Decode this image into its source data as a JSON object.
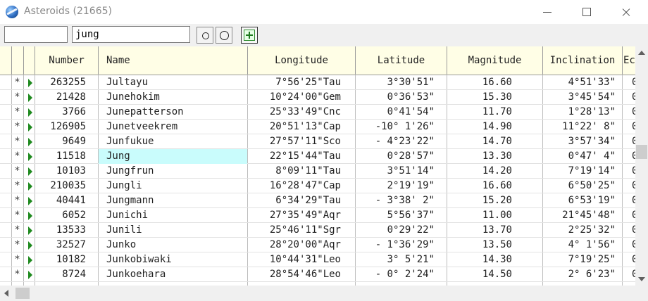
{
  "window": {
    "title": "Asteroids (21665)"
  },
  "toolbar": {
    "filter1_value": "",
    "search_value": "jung"
  },
  "columns": {
    "number": "Number",
    "name": "Name",
    "longitude": "Longitude",
    "latitude": "Latitude",
    "magnitude": "Magnitude",
    "inclination": "Inclination",
    "ecc": "Ec"
  },
  "rows": [
    {
      "marker": "*",
      "number": "263255",
      "name": "Jultayu",
      "longitude": "7°56'25\"Tau",
      "latitude": "3°30'51\"",
      "magnitude": "16.60",
      "inclination": "4°51'33\"",
      "ecc": "0"
    },
    {
      "marker": "*",
      "number": "21428",
      "name": "Junehokim",
      "longitude": "10°24'00\"Gem",
      "latitude": "0°36'53\"",
      "magnitude": "15.30",
      "inclination": "3°45'54\"",
      "ecc": "0"
    },
    {
      "marker": "*",
      "number": "3766",
      "name": "Junepatterson",
      "longitude": "25°33'49\"Cnc",
      "latitude": "0°41'54\"",
      "magnitude": "11.70",
      "inclination": "1°28'13\"",
      "ecc": "0"
    },
    {
      "marker": "*",
      "number": "126905",
      "name": "Junetveekrem",
      "longitude": "20°51'13\"Cap",
      "latitude": "-10° 1'26\"",
      "magnitude": "14.90",
      "inclination": "11°22' 8\"",
      "ecc": "0"
    },
    {
      "marker": "*",
      "number": "9649",
      "name": "Junfukue",
      "longitude": "27°57'11\"Sco",
      "latitude": "- 4°23'22\"",
      "magnitude": "14.70",
      "inclination": "3°57'34\"",
      "ecc": "0"
    },
    {
      "marker": "*",
      "number": "11518",
      "name": "Jung",
      "longitude": "22°15'44\"Tau",
      "latitude": "0°28'57\"",
      "magnitude": "13.30",
      "inclination": "0°47' 4\"",
      "ecc": "0",
      "selected": true
    },
    {
      "marker": "*",
      "number": "10103",
      "name": "Jungfrun",
      "longitude": "8°09'11\"Tau",
      "latitude": "3°51'14\"",
      "magnitude": "14.20",
      "inclination": "7°19'14\"",
      "ecc": "0"
    },
    {
      "marker": "*",
      "number": "210035",
      "name": "Jungli",
      "longitude": "16°28'47\"Cap",
      "latitude": "2°19'19\"",
      "magnitude": "16.60",
      "inclination": "6°50'25\"",
      "ecc": "0"
    },
    {
      "marker": "*",
      "number": "40441",
      "name": "Jungmann",
      "longitude": "6°34'29\"Tau",
      "latitude": "- 3°38' 2\"",
      "magnitude": "15.20",
      "inclination": "6°53'19\"",
      "ecc": "0"
    },
    {
      "marker": "*",
      "number": "6052",
      "name": "Junichi",
      "longitude": "27°35'49\"Aqr",
      "latitude": "5°56'37\"",
      "magnitude": "11.00",
      "inclination": "21°45'48\"",
      "ecc": "0"
    },
    {
      "marker": "*",
      "number": "13533",
      "name": "Junili",
      "longitude": "25°46'11\"Sgr",
      "latitude": "0°29'22\"",
      "magnitude": "13.70",
      "inclination": "2°25'32\"",
      "ecc": "0"
    },
    {
      "marker": "*",
      "number": "32527",
      "name": "Junko",
      "longitude": "28°20'00\"Aqr",
      "latitude": "- 1°36'29\"",
      "magnitude": "13.50",
      "inclination": "4° 1'56\"",
      "ecc": "0"
    },
    {
      "marker": "*",
      "number": "10182",
      "name": "Junkobiwaki",
      "longitude": "10°44'31\"Leo",
      "latitude": "3° 5'21\"",
      "magnitude": "14.30",
      "inclination": "7°19'25\"",
      "ecc": "0"
    },
    {
      "marker": "*",
      "number": "8724",
      "name": "Junkoehara",
      "longitude": "28°54'46\"Leo",
      "latitude": "- 0° 2'24\"",
      "magnitude": "14.50",
      "inclination": "2° 6'23\"",
      "ecc": "0"
    }
  ]
}
